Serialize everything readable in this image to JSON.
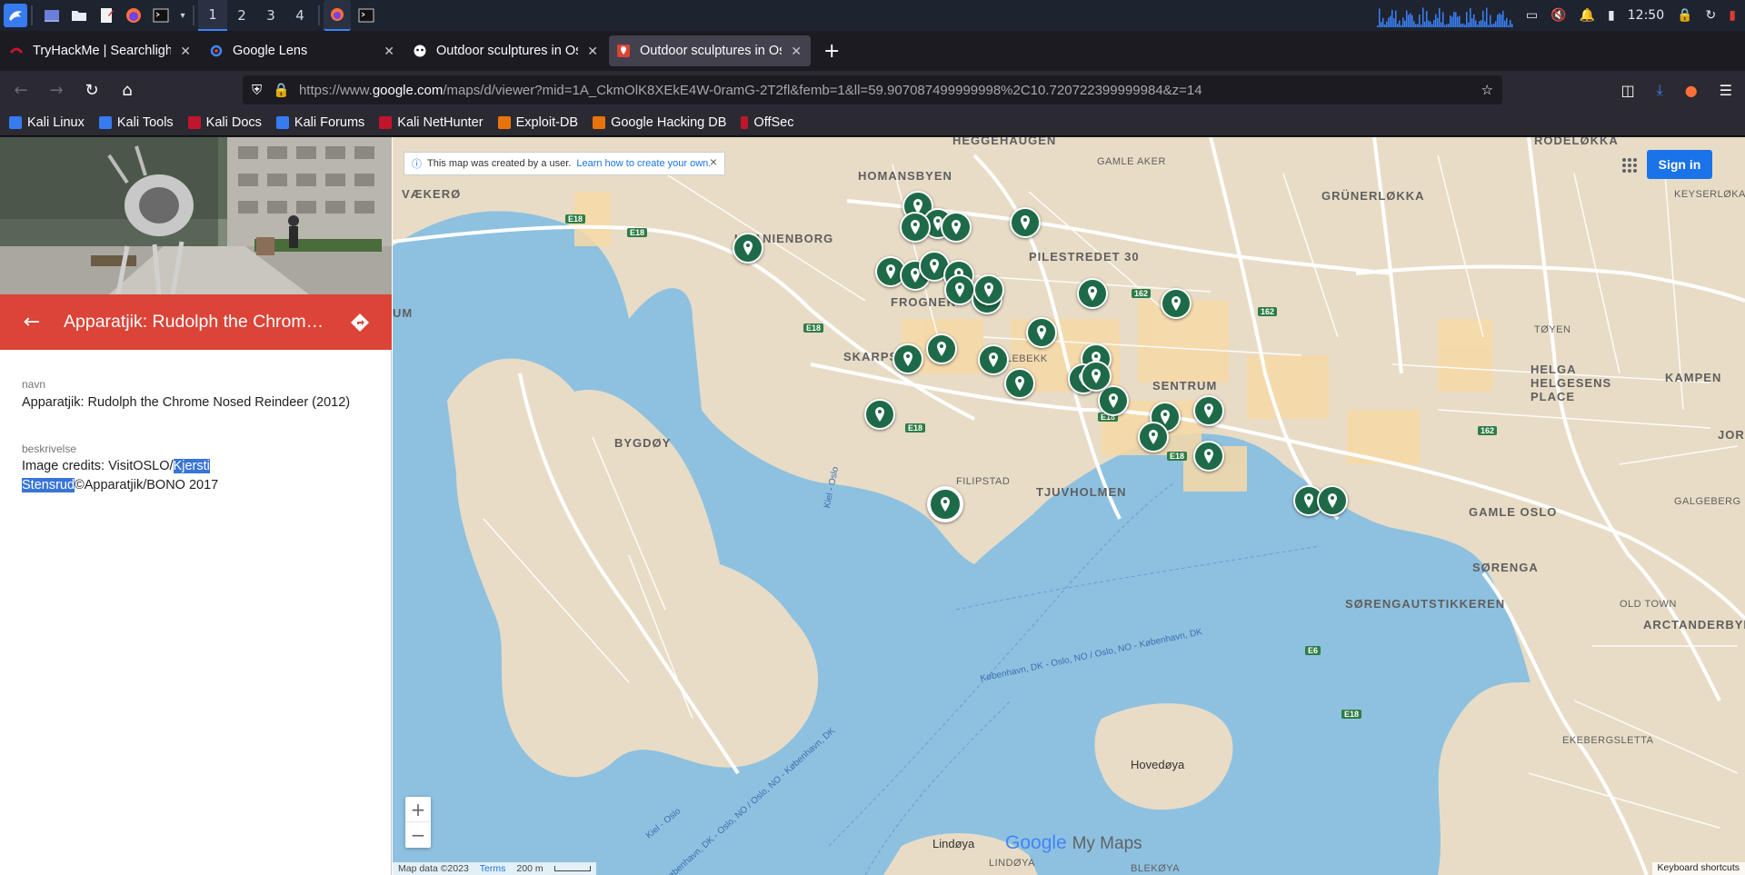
{
  "taskbar": {
    "workspaces": [
      "1",
      "2",
      "3",
      "4"
    ],
    "active_workspace": "1",
    "clock": "12:50"
  },
  "tabs": [
    {
      "title": "TryHackMe | Searchlight -",
      "active": false,
      "fav_color": "#c0152c"
    },
    {
      "title": "Google Lens",
      "active": false,
      "fav_color": "#4285f4"
    },
    {
      "title": "Outdoor sculptures in Oslo",
      "active": false,
      "fav_color": "#ffffff"
    },
    {
      "title": "Outdoor sculptures in Oslo",
      "active": true,
      "fav_color": "#db4437"
    }
  ],
  "url": {
    "prefix": "https://www.",
    "domain": "google.com",
    "path": "/maps/d/viewer?mid=1A_CkmOlK8XEkE4W-0ramG-2T2fl&femb=1&ll=59.907087499999998%2C10.720722399999984&z=14"
  },
  "bookmarks": [
    {
      "label": "Kali Linux",
      "color": "#367bf0"
    },
    {
      "label": "Kali Tools",
      "color": "#367bf0"
    },
    {
      "label": "Kali Docs",
      "color": "#c0152c"
    },
    {
      "label": "Kali Forums",
      "color": "#367bf0"
    },
    {
      "label": "Kali NetHunter",
      "color": "#c0152c"
    },
    {
      "label": "Exploit-DB",
      "color": "#e8730c"
    },
    {
      "label": "Google Hacking DB",
      "color": "#e8730c"
    },
    {
      "label": "OffSec",
      "color": "#c0152c"
    }
  ],
  "panel": {
    "title": "Apparatjik: Rudolph the Chrom…",
    "name_label": "navn",
    "name_value": "Apparatjik: Rudolph the Chrome Nosed Reindeer (2012)",
    "desc_label": "beskrivelse",
    "desc_before": "Image credits: VisitOSLO/",
    "desc_selected": "Kjersti Stensrud",
    "desc_after": "©Apparatjik/BONO 2017",
    "accent": "#db4437"
  },
  "map": {
    "notice_text": "This map was created by a user.",
    "notice_link": "Learn how to create your own.",
    "sign_in": "Sign in",
    "zoom_in": "+",
    "zoom_out": "−",
    "brand_google": "Google",
    "brand_mymaps": "My Maps",
    "attribution": "Map data ©2023",
    "terms": "Terms",
    "scale": "200 m",
    "keyboard": "Keyboard shortcuts",
    "pin_color": "#1e6a48",
    "water_color": "#8ec1e0",
    "land_color": "#e8dcc6",
    "labels": {
      "heggehaugen": "HEGGEHAUGEN",
      "homansbyen": "HOMANSBYEN",
      "gamle_aker": "GAMLE AKER",
      "grunerlokka": "GRÜNERLØKKA",
      "rodelokka": "RODELØKKA",
      "keyserlokka": "KEYSERLØKA",
      "uranienborg": "URANIENBORG",
      "pilestredet": "PILESTREDET 30",
      "frogner": "FROGNER",
      "skarpsno": "SKARPSNO",
      "skillebekk": "SKILLEBEKK",
      "sentrum": "SENTRUM",
      "toyen": "TØYEN",
      "helga": "HELGA",
      "helgesens": "HELGESENS",
      "place": "PLACE",
      "kampen": "KAMPEN",
      "bygdoy": "BYGDØY",
      "filipstad": "FILIPSTAD",
      "tjuvholmen": "TJUVHOLMEN",
      "gamle_oslo": "GAMLE OSLO",
      "sorenga": "SØRENGA",
      "sorengautstikkeren": "SØRENGAUTSTIKKEREN",
      "old_town": "OLD TOWN",
      "arctanderbyen": "ARCTANDERBYEN",
      "ekebergsletta": "EKEBERGSLETTA",
      "galgeberg": "GALGEBERG",
      "hovedoya": "Hovedøya",
      "lindoya": "Lindøya",
      "lindoya_small": "LINDØYA",
      "blekoya": "BLEKØYA",
      "vaekero": "VÆKERØ",
      "um": "UM",
      "jord": "JORD",
      "ferry1": "København, DK - Oslo, NO / Oslo, NO - København, DK",
      "ferry2": "Kiel - Oslo",
      "ferry3": "København, DK - Oslo, NO / Oslo, NO - København, DK",
      "kiel_oslo": "Kiel - Oslo"
    }
  }
}
